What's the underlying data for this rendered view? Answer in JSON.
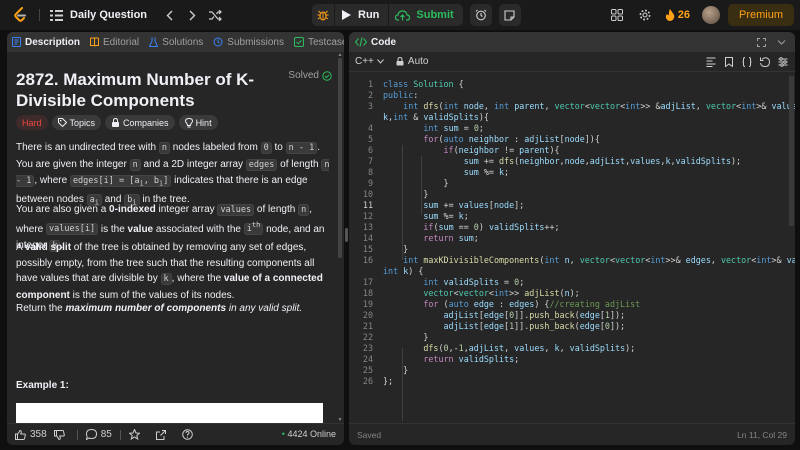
{
  "colors": {
    "accent": "#ffa116",
    "success": "#2cbb5d",
    "hard": "#ef4743",
    "background": "#0f0f0f",
    "panel": "#262626"
  },
  "topbar": {
    "title": "Daily Question",
    "run_label": "Run",
    "submit_label": "Submit",
    "streak_count": "26",
    "premium_label": "Premium"
  },
  "left_tabs": [
    "Description",
    "Editorial",
    "Solutions",
    "Submissions",
    "Testcase"
  ],
  "problem": {
    "title": "2872. Maximum Number of K-Divisible Components",
    "status": "Solved",
    "difficulty": "Hard",
    "chip_topics": "Topics",
    "chip_companies": "Companies",
    "chip_hint": "Hint",
    "p1": {
      "t1": "There is an undirected tree with ",
      "c1": "n",
      "t2": " nodes labeled from ",
      "c2": "0",
      "t3": " to ",
      "c3": "n - 1",
      "t4": ". You are given the integer ",
      "c4": "n",
      "t5": " and a 2D integer array ",
      "c5": "edges",
      "t6": " of length ",
      "c6": "n - 1",
      "t7": ", where ",
      "c7": "edges[i] = [a",
      "c7b": "i",
      "c7c": ", b",
      "c7d": "i",
      "c7e": "]",
      "t8": " indicates that there is an edge between nodes ",
      "c8": "a",
      "c8s": "i",
      "t9": " and ",
      "c9": "b",
      "c9s": "i",
      "t10": " in the tree."
    },
    "p2": {
      "t1": "You are also given a ",
      "b1": "0-indexed",
      "t2": " integer array ",
      "c1": "values",
      "t3": " of length ",
      "c2": "n",
      "t4": ", where ",
      "c3": "values[i]",
      "t5": " is the ",
      "b2": "value",
      "t6": " associated with the ",
      "sup_base": "i",
      "sup": "th",
      "t7": " node, and an integer ",
      "c4": "k",
      "t8": "."
    },
    "p3": {
      "t1": "A ",
      "b1": "valid split",
      "t2": " of the tree is obtained by removing any set of edges, possibly empty, from the tree such that the resulting components all have values that are divisible by ",
      "c1": "k",
      "t3": ", where the ",
      "b2": "value of a connected component",
      "t4": " is the sum of the values of its nodes."
    },
    "p4": {
      "t1": "Return the ",
      "bi": "maximum number of components",
      "t2": " in any valid split."
    },
    "example_title": "Example 1:",
    "likes": "358",
    "comments": "85",
    "online": "4424 Online"
  },
  "code": {
    "header": "Code",
    "language": "C++",
    "auto_label": "Auto",
    "saved_label": "Saved",
    "cursor_position": "Ln 11, Col 29",
    "current_line": 11,
    "lines": [
      "1",
      "2",
      "3",
      "",
      "4",
      "5",
      "6",
      "7",
      "8",
      "9",
      "10",
      "11",
      "12",
      "13",
      "14",
      "15",
      "16",
      "",
      "17",
      "18",
      "19",
      "20",
      "21",
      "22",
      "23",
      "24",
      "25",
      "26"
    ]
  }
}
